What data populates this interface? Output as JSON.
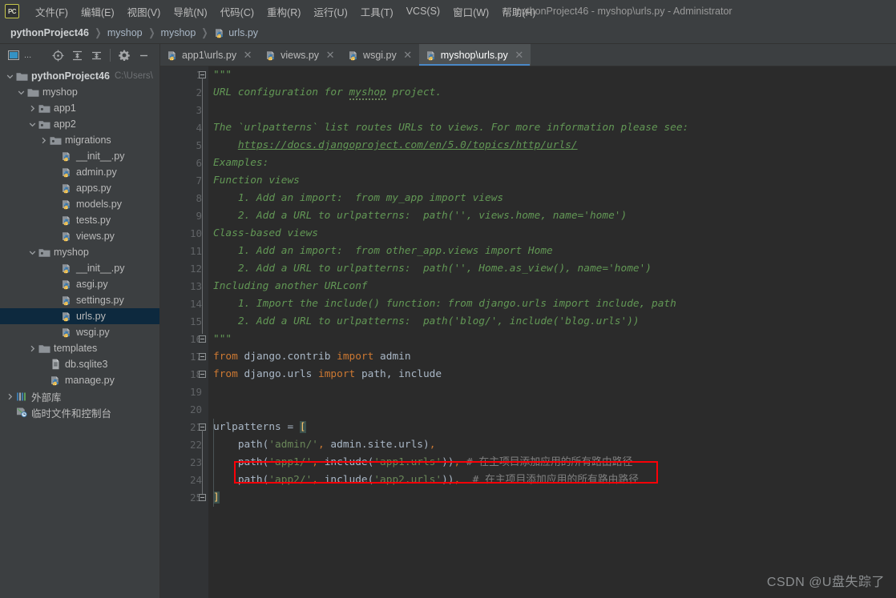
{
  "window": {
    "title": "pythonProject46 - myshop\\urls.py - Administrator",
    "logo": "PC"
  },
  "menubar": {
    "items": [
      {
        "label": "文件(F)",
        "name": "menu-file"
      },
      {
        "label": "编辑(E)",
        "name": "menu-edit"
      },
      {
        "label": "视图(V)",
        "name": "menu-view"
      },
      {
        "label": "导航(N)",
        "name": "menu-navigate"
      },
      {
        "label": "代码(C)",
        "name": "menu-code"
      },
      {
        "label": "重构(R)",
        "name": "menu-refactor"
      },
      {
        "label": "运行(U)",
        "name": "menu-run"
      },
      {
        "label": "工具(T)",
        "name": "menu-tools"
      },
      {
        "label": "VCS(S)",
        "name": "menu-vcs"
      },
      {
        "label": "窗口(W)",
        "name": "menu-window"
      },
      {
        "label": "帮助(H)",
        "name": "menu-help"
      }
    ]
  },
  "breadcrumb": {
    "items": [
      {
        "label": "pythonProject46",
        "icon": "none"
      },
      {
        "label": "myshop",
        "icon": "none"
      },
      {
        "label": "myshop",
        "icon": "none"
      },
      {
        "label": "urls.py",
        "icon": "python-file-icon"
      }
    ],
    "separator": "❯"
  },
  "project_toolbar": {
    "buttons": [
      {
        "name": "project-view-icon",
        "label": "..."
      },
      {
        "name": "locate-file-icon",
        "label": ""
      },
      {
        "name": "expand-all-icon",
        "label": ""
      },
      {
        "name": "collapse-all-icon",
        "label": ""
      },
      {
        "name": "settings-gear-icon",
        "label": ""
      },
      {
        "name": "hide-panel-icon",
        "label": ""
      }
    ]
  },
  "tree": {
    "items": [
      {
        "indent": 0,
        "arrow": "down",
        "icon": "folder-project-icon",
        "label": "pythonProject46",
        "bold": true,
        "sub": "C:\\Users\\",
        "selected": false
      },
      {
        "indent": 1,
        "arrow": "down",
        "icon": "folder-icon",
        "label": "myshop",
        "bold": false,
        "sub": "",
        "selected": false
      },
      {
        "indent": 2,
        "arrow": "right",
        "icon": "module-folder-icon",
        "label": "app1",
        "bold": false,
        "sub": "",
        "selected": false
      },
      {
        "indent": 2,
        "arrow": "down",
        "icon": "module-folder-icon",
        "label": "app2",
        "bold": false,
        "sub": "",
        "selected": false
      },
      {
        "indent": 3,
        "arrow": "right",
        "icon": "module-folder-icon",
        "label": "migrations",
        "bold": false,
        "sub": "",
        "selected": false
      },
      {
        "indent": 4,
        "arrow": "none",
        "icon": "python-file-icon",
        "label": "__init__.py",
        "bold": false,
        "sub": "",
        "selected": false
      },
      {
        "indent": 4,
        "arrow": "none",
        "icon": "python-file-icon",
        "label": "admin.py",
        "bold": false,
        "sub": "",
        "selected": false
      },
      {
        "indent": 4,
        "arrow": "none",
        "icon": "python-file-icon",
        "label": "apps.py",
        "bold": false,
        "sub": "",
        "selected": false
      },
      {
        "indent": 4,
        "arrow": "none",
        "icon": "python-file-icon",
        "label": "models.py",
        "bold": false,
        "sub": "",
        "selected": false
      },
      {
        "indent": 4,
        "arrow": "none",
        "icon": "python-file-icon",
        "label": "tests.py",
        "bold": false,
        "sub": "",
        "selected": false
      },
      {
        "indent": 4,
        "arrow": "none",
        "icon": "python-file-icon",
        "label": "views.py",
        "bold": false,
        "sub": "",
        "selected": false
      },
      {
        "indent": 2,
        "arrow": "down",
        "icon": "module-folder-icon",
        "label": "myshop",
        "bold": false,
        "sub": "",
        "selected": false
      },
      {
        "indent": 4,
        "arrow": "none",
        "icon": "python-file-icon",
        "label": "__init__.py",
        "bold": false,
        "sub": "",
        "selected": false
      },
      {
        "indent": 4,
        "arrow": "none",
        "icon": "python-file-icon",
        "label": "asgi.py",
        "bold": false,
        "sub": "",
        "selected": false
      },
      {
        "indent": 4,
        "arrow": "none",
        "icon": "python-file-icon",
        "label": "settings.py",
        "bold": false,
        "sub": "",
        "selected": false
      },
      {
        "indent": 4,
        "arrow": "none",
        "icon": "python-file-icon",
        "label": "urls.py",
        "bold": false,
        "sub": "",
        "selected": true
      },
      {
        "indent": 4,
        "arrow": "none",
        "icon": "python-file-icon",
        "label": "wsgi.py",
        "bold": false,
        "sub": "",
        "selected": false
      },
      {
        "indent": 2,
        "arrow": "right",
        "icon": "folder-icon",
        "label": "templates",
        "bold": false,
        "sub": "",
        "selected": false
      },
      {
        "indent": 3,
        "arrow": "none",
        "icon": "db-file-icon",
        "label": "db.sqlite3",
        "bold": false,
        "sub": "",
        "selected": false
      },
      {
        "indent": 3,
        "arrow": "none",
        "icon": "python-file-icon",
        "label": "manage.py",
        "bold": false,
        "sub": "",
        "selected": false
      },
      {
        "indent": 0,
        "arrow": "right",
        "icon": "external-libraries-icon",
        "label": "外部库",
        "bold": false,
        "sub": "",
        "selected": false
      },
      {
        "indent": 0,
        "arrow": "none",
        "icon": "scratches-icon",
        "label": "临时文件和控制台",
        "bold": false,
        "sub": "",
        "selected": false
      }
    ]
  },
  "editor_tabs": {
    "items": [
      {
        "label": "app1\\urls.py",
        "icon": "python-file-icon",
        "active": false,
        "close": "✕"
      },
      {
        "label": "views.py",
        "icon": "python-file-icon",
        "active": false,
        "close": "✕"
      },
      {
        "label": "wsgi.py",
        "icon": "python-file-icon",
        "active": false,
        "close": "✕"
      },
      {
        "label": "myshop\\urls.py",
        "icon": "python-file-icon",
        "active": true,
        "close": "✕"
      }
    ]
  },
  "editor": {
    "line_numbers": [
      "1",
      "2",
      "3",
      "4",
      "5",
      "6",
      "7",
      "8",
      "9",
      "10",
      "11",
      "12",
      "13",
      "14",
      "15",
      "16",
      "17",
      "18",
      "19",
      "20",
      "21",
      "22",
      "23",
      "24",
      "25"
    ],
    "lines": [
      {
        "n": 1,
        "html": "<span class=\"doc\">&quot;&quot;&quot;</span>"
      },
      {
        "n": 2,
        "html": "<span class=\"doc\">URL configuration for </span><span class=\"doc typo\">myshop</span><span class=\"doc\"> project.</span>"
      },
      {
        "n": 3,
        "html": ""
      },
      {
        "n": 4,
        "html": "<span class=\"doc\">The `urlpatterns` list routes URLs to views. For more information please see:</span>"
      },
      {
        "n": 5,
        "html": "<span class=\"doc\">    </span><span class=\"link\">https://docs.djangoproject.com/en/5.0/topics/http/urls/</span>"
      },
      {
        "n": 6,
        "html": "<span class=\"doc\">Examples:</span>"
      },
      {
        "n": 7,
        "html": "<span class=\"doc\">Function views</span>"
      },
      {
        "n": 8,
        "html": "<span class=\"doc\">    1. Add an import:  from my_app import views</span>"
      },
      {
        "n": 9,
        "html": "<span class=\"doc\">    2. Add a URL to urlpatterns:  path('', views.home, name='home')</span>"
      },
      {
        "n": 10,
        "html": "<span class=\"doc\">Class-based views</span>"
      },
      {
        "n": 11,
        "html": "<span class=\"doc\">    1. Add an import:  from other_app.views import Home</span>"
      },
      {
        "n": 12,
        "html": "<span class=\"doc\">    2. Add a URL to urlpatterns:  path('', Home.as_view(), name='home')</span>"
      },
      {
        "n": 13,
        "html": "<span class=\"doc\">Including another URLconf</span>"
      },
      {
        "n": 14,
        "html": "<span class=\"doc\">    1. Import the include() function: from django.urls import include, path</span>"
      },
      {
        "n": 15,
        "html": "<span class=\"doc\">    2. Add a URL to urlpatterns:  path('blog/', include('blog.urls'))</span>"
      },
      {
        "n": 16,
        "html": "<span class=\"doc\">&quot;&quot;&quot;</span>"
      },
      {
        "n": 17,
        "html": "<span class=\"kw\">from</span> django.contrib <span class=\"kw\">import</span> admin"
      },
      {
        "n": 18,
        "html": "<span class=\"kw\">from</span> django.urls <span class=\"kw\">import</span> path, include"
      },
      {
        "n": 19,
        "html": ""
      },
      {
        "n": 20,
        "html": ""
      },
      {
        "n": 21,
        "html": "urlpatterns = <span class=\"brk-hl\">[</span>"
      },
      {
        "n": 22,
        "html": "    path(<span class=\"str\">'admin/'</span><span class=\"kw\">,</span> admin.site.urls)<span class=\"kw\">,</span>"
      },
      {
        "n": 23,
        "html": "    path(<span class=\"str\">'app1/'</span><span class=\"kw\">,</span> include(<span class=\"str\">'app1.urls'</span>))<span class=\"kw\">,</span> <span class=\"com\"># 在主项目添加应用的所有路由路径</span>"
      },
      {
        "n": 24,
        "html": "    path(<span class=\"str\">'app2/'</span><span class=\"kw\">,</span> include(<span class=\"str\">'app2.urls'</span>))<span class=\"kw\">,</span>  <span class=\"com\"># 在主项目添加应用的所有路由路径</span>"
      },
      {
        "n": 25,
        "html": "<span class=\"brk-hl\">]</span>"
      }
    ],
    "annotation": {
      "name": "red-highlight-box",
      "color": "#fb0007",
      "target_line": 24
    }
  },
  "watermark": {
    "text": "CSDN @U盘失踪了"
  }
}
